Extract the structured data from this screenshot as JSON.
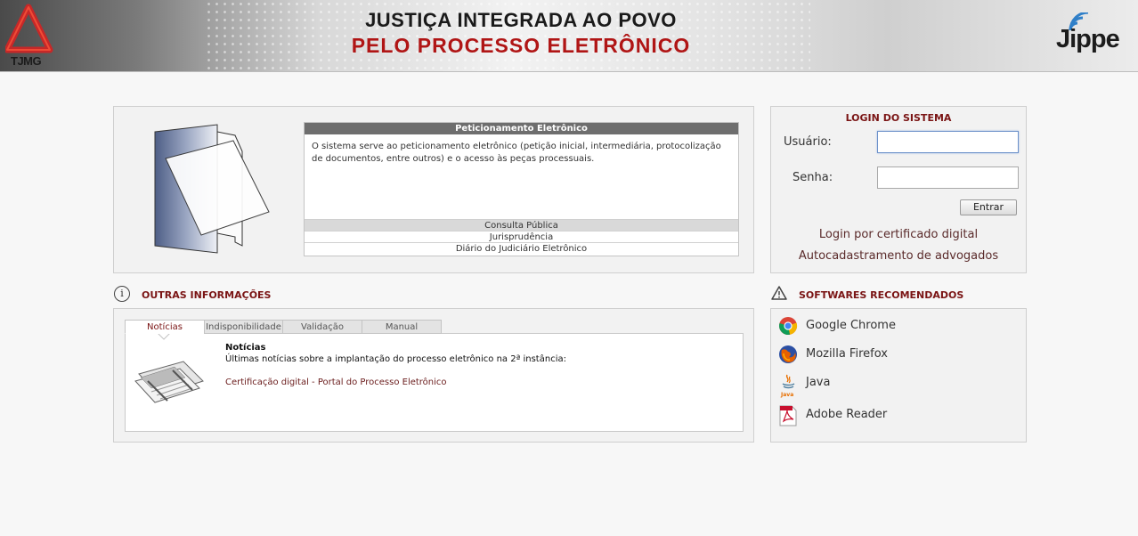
{
  "header": {
    "logo_left_text": "TJMG",
    "title_line1": "JUSTIÇA INTEGRADA AO POVO",
    "title_line2": "PELO PROCESSO ELETRÔNICO",
    "logo_right_text": "Jippe"
  },
  "peticionamento": {
    "title": "Peticionamento Eletrônico",
    "description": "O sistema serve ao peticionamento eletrônico (petição inicial, intermediária, protocolização de documentos, entre outros) e o acesso às peças processuais.",
    "links": [
      "Consulta Pública",
      "Jurisprudência",
      "Diário do Judiciário Eletrônico"
    ]
  },
  "login": {
    "title": "LOGIN DO SISTEMA",
    "user_label": "Usuário:",
    "user_value": "",
    "password_label": "Senha:",
    "password_value": "",
    "submit_label": "Entrar",
    "cert_link": "Login por certificado digital",
    "register_link": "Autocadastramento de advogados"
  },
  "info": {
    "title": "OUTRAS INFORMAÇÕES",
    "tabs": [
      "Notícias",
      "Indisponibilidade",
      "Validação",
      "Manual"
    ],
    "active_tab": "Notícias",
    "news_title": "Notícias",
    "news_subtitle": "Últimas notícias sobre a implantação do processo eletrônico na 2ª instância:",
    "news_link": "Certificação digital - Portal do Processo Eletrônico"
  },
  "software": {
    "title": "SOFTWARES RECOMENDADOS",
    "items": [
      {
        "name": "Google Chrome",
        "icon": "chrome-icon"
      },
      {
        "name": "Mozilla Firefox",
        "icon": "firefox-icon"
      },
      {
        "name": "Java",
        "icon": "java-icon"
      },
      {
        "name": "Adobe Reader",
        "icon": "adobe-reader-icon"
      }
    ]
  },
  "colors": {
    "accent_red": "#b01515",
    "section_title": "#7a1414",
    "header_bar": "#6e6e6e"
  }
}
